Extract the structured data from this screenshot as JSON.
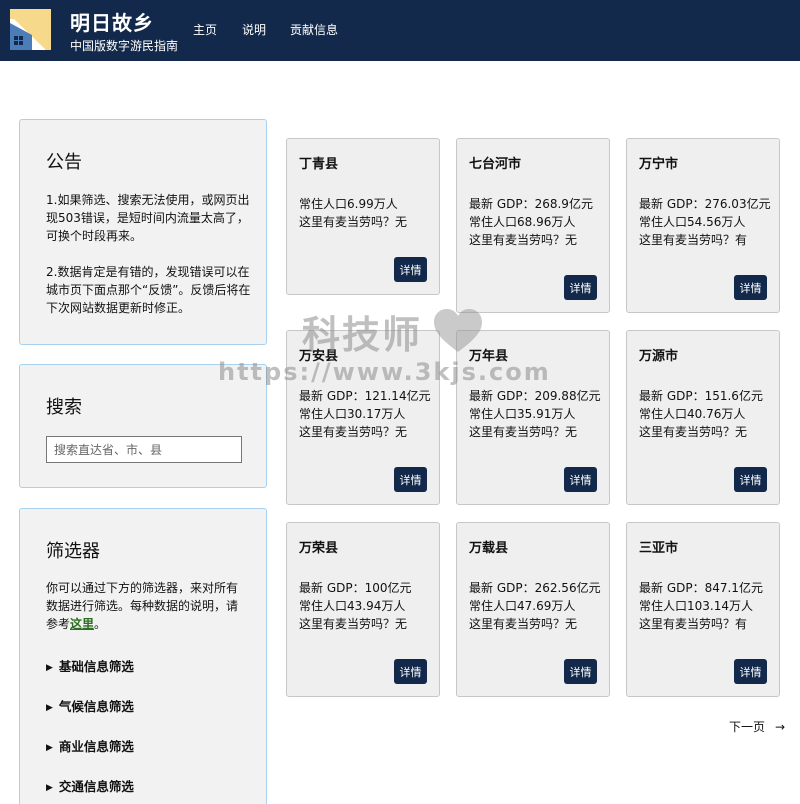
{
  "header": {
    "title": "明日故乡",
    "subtitle": "中国版数字游民指南",
    "nav": [
      "主页",
      "说明",
      "贡献信息"
    ]
  },
  "notice": {
    "title": "公告",
    "p1": "1.如果筛选、搜索无法使用，或网页出现503错误，是短时间内流量太高了，可换个时段再来。",
    "p2": "2.数据肯定是有错的，发现错误可以在城市页下面点那个“反馈”。反馈后将在下次网站数据更新时修正。"
  },
  "search": {
    "title": "搜索",
    "placeholder": "搜索直达省、市、县"
  },
  "filter": {
    "title": "筛选器",
    "desc": "你可以通过下方的筛选器，来对所有数据进行筛选。每种数据的说明，请参考",
    "link": "这里",
    "desc_end": "。",
    "items": [
      "基础信息筛选",
      "气候信息筛选",
      "商业信息筛选",
      "交通信息筛选"
    ]
  },
  "cities": [
    {
      "name": "丁青县",
      "gdp": "",
      "pop": "常住人口6.99万人",
      "mcd": "这里有麦当劳吗？无"
    },
    {
      "name": "七台河市",
      "gdp": "最新 GDP：268.9亿元",
      "pop": "常住人口68.96万人",
      "mcd": "这里有麦当劳吗？无"
    },
    {
      "name": "万宁市",
      "gdp": "最新 GDP：276.03亿元",
      "pop": "常住人口54.56万人",
      "mcd": "这里有麦当劳吗？有"
    },
    {
      "name": "万安县",
      "gdp": "最新 GDP：121.14亿元",
      "pop": "常住人口30.17万人",
      "mcd": "这里有麦当劳吗？无"
    },
    {
      "name": "万年县",
      "gdp": "最新 GDP：209.88亿元",
      "pop": "常住人口35.91万人",
      "mcd": "这里有麦当劳吗？无"
    },
    {
      "name": "万源市",
      "gdp": "最新 GDP：151.6亿元",
      "pop": "常住人口40.76万人",
      "mcd": "这里有麦当劳吗？无"
    },
    {
      "name": "万荣县",
      "gdp": "最新 GDP：100亿元",
      "pop": "常住人口43.94万人",
      "mcd": "这里有麦当劳吗？无"
    },
    {
      "name": "万载县",
      "gdp": "最新 GDP：262.56亿元",
      "pop": "常住人口47.69万人",
      "mcd": "这里有麦当劳吗？无"
    },
    {
      "name": "三亚市",
      "gdp": "最新 GDP：847.1亿元",
      "pop": "常住人口103.14万人",
      "mcd": "这里有麦当劳吗？有"
    }
  ],
  "detail_label": "详情",
  "pagination": {
    "next": "下一页",
    "arrow": "→"
  },
  "watermark": {
    "line1": "科技师",
    "line2": "https://www.3kjs.com"
  },
  "colors": {
    "header_bg": "#13294b",
    "button_bg": "#13294b",
    "side_border": "#a9d2ee",
    "link": "#2a6e1f"
  }
}
